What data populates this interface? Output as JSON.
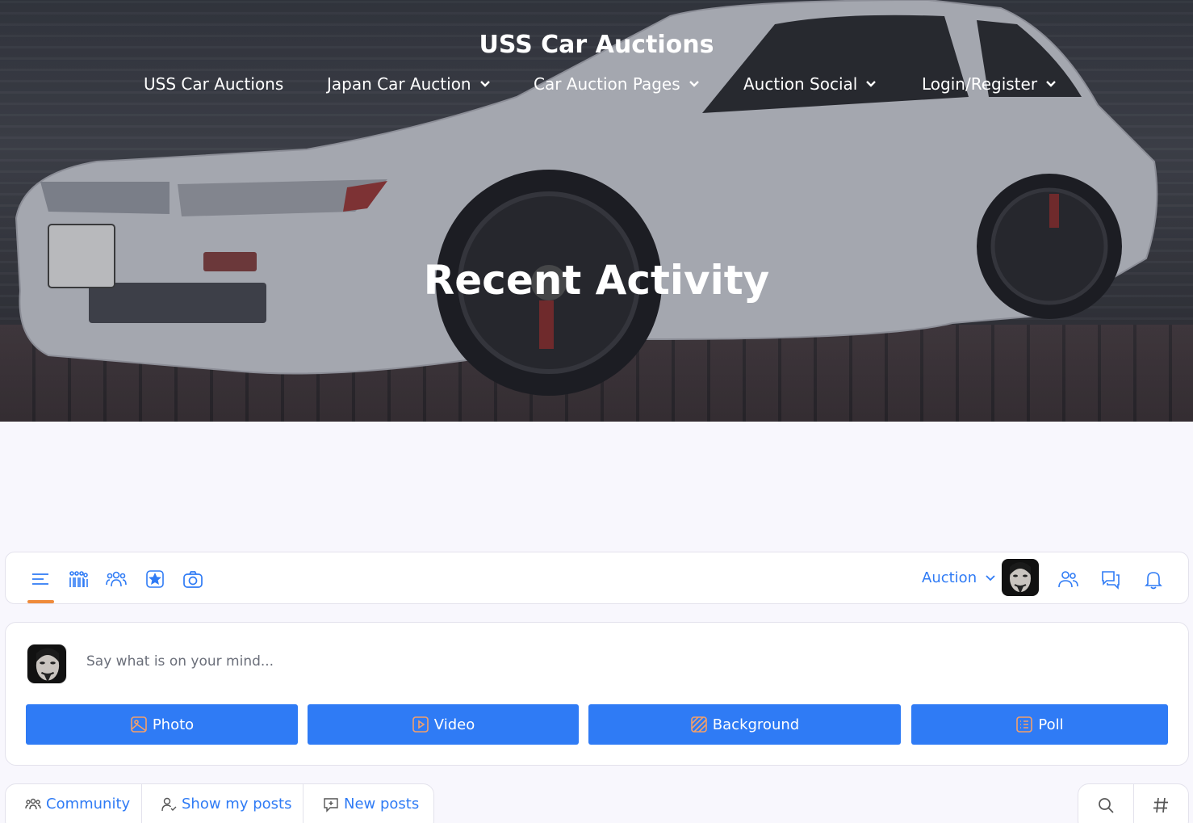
{
  "site": {
    "title": "USS Car Auctions"
  },
  "nav": {
    "items": [
      {
        "label": "USS Car Auctions"
      },
      {
        "label": "Japan Car Auction"
      },
      {
        "label": "Car Auction Pages"
      },
      {
        "label": "Auction Social"
      },
      {
        "label": "Login/Register"
      }
    ]
  },
  "hero": {
    "heading": "Recent Activity"
  },
  "toolbar": {
    "icons": [
      "activity-feed-icon",
      "groups-icon",
      "members-icon",
      "favorites-icon",
      "camera-icon"
    ],
    "auction_label": "Auction",
    "right_icons": [
      "friends-icon",
      "messages-icon",
      "notifications-icon"
    ]
  },
  "composer": {
    "placeholder": "Say what is on your mind...",
    "buttons": [
      {
        "label": "Photo",
        "icon": "photo-icon"
      },
      {
        "label": "Video",
        "icon": "video-icon"
      },
      {
        "label": "Background",
        "icon": "background-icon"
      },
      {
        "label": "Poll",
        "icon": "poll-icon"
      }
    ]
  },
  "filters": {
    "tabs": [
      {
        "label": "Community",
        "icon": "community-icon"
      },
      {
        "label": "Show my posts",
        "icon": "user-icon"
      },
      {
        "label": "New posts",
        "icon": "new-posts-icon"
      }
    ],
    "tools": [
      "search-icon",
      "hashtag-icon"
    ]
  },
  "colors": {
    "accent": "#2f7bf5",
    "active_indicator": "#ef8b3b",
    "page_bg": "#f8f7fd"
  }
}
